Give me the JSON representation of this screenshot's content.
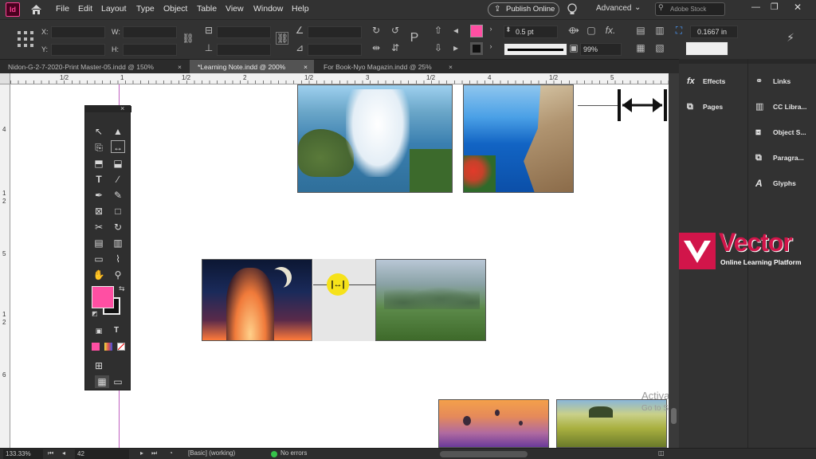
{
  "app": {
    "logo": "Id",
    "home_icon": "home-icon"
  },
  "menu": [
    "File",
    "Edit",
    "Layout",
    "Type",
    "Object",
    "Table",
    "View",
    "Window",
    "Help"
  ],
  "header": {
    "publish": "Publish Online",
    "workspace": "Advanced",
    "search_placeholder": "Adobe Stock"
  },
  "control": {
    "x_label": "X:",
    "y_label": "Y:",
    "w_label": "W:",
    "h_label": "H:",
    "stroke_weight": "0.5 pt",
    "zoom_percent": "99%",
    "gap_value": "0.1667 in",
    "fill_color": "#ff4fa3"
  },
  "tabs": [
    {
      "label": "Nidon-G-2-7-2020-Print Master-05.indd @ 150%"
    },
    {
      "label": "*Learning Note.indd @ 200%"
    },
    {
      "label": "For Book-Nyo Magazin.indd @ 25%"
    }
  ],
  "ruler_h": [
    "1/2",
    "1",
    "1/2",
    "2",
    "1/2",
    "3",
    "1/2",
    "4",
    "1/2",
    "5"
  ],
  "ruler_v": [
    "4",
    "1",
    "2",
    "5",
    "1",
    "2",
    "6"
  ],
  "panels": {
    "left": [
      {
        "label": "Effects",
        "icon": "fx-icon"
      },
      {
        "label": "Pages",
        "icon": "pages-icon"
      }
    ],
    "right": [
      {
        "label": "Links",
        "icon": "links-icon"
      },
      {
        "label": "CC Libra...",
        "icon": "cc-libraries-icon"
      },
      {
        "label": "Object S...",
        "icon": "object-styles-icon"
      },
      {
        "label": "Paragra...",
        "icon": "paragraph-icon"
      },
      {
        "label": "Glyphs",
        "icon": "glyphs-icon"
      }
    ]
  },
  "watermark": {
    "brand": "Vector",
    "tagline": "Online Learning Platform",
    "brand_color": "#d1154a"
  },
  "activate": {
    "title": "Activate Windows",
    "subtitle": "Go to Settings to activate Windows."
  },
  "status": {
    "zoom": "133.33%",
    "page": "42",
    "style": "[Basic] (working)",
    "errors": "No errors"
  }
}
